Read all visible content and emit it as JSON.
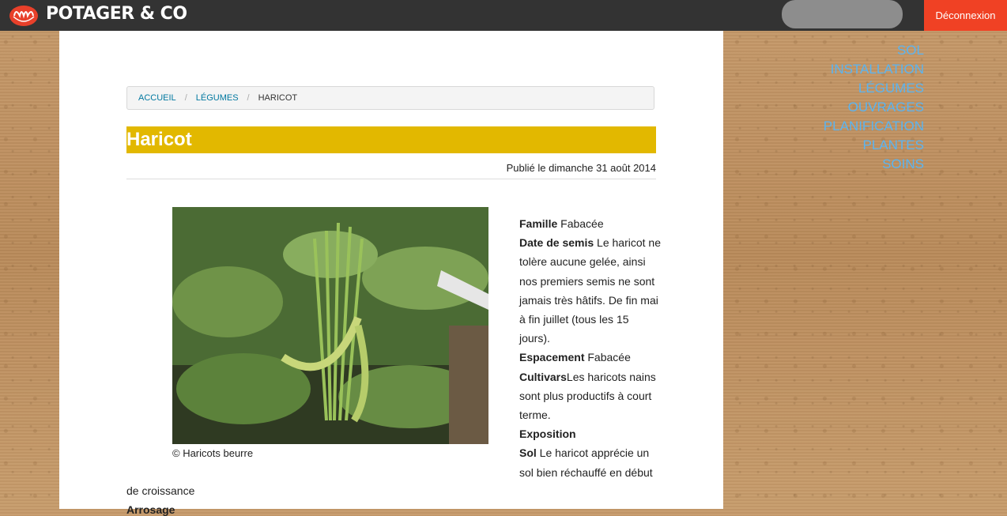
{
  "header": {
    "brand": "POTAGER & CO",
    "logout_label": "Déconnexion",
    "search_placeholder": ""
  },
  "breadcrumb": {
    "items": [
      "ACCUEIL",
      "LÉGUMES",
      "HARICOT"
    ]
  },
  "article": {
    "title": "Haricot",
    "published": "Publié le dimanche 31 août 2014",
    "caption": "© Haricots beurre",
    "famille_label": "Famille",
    "famille_value": " Fabacée",
    "semis_label": "Date de semis",
    "semis_value": " Le haricot ne tolère aucune gelée, ainsi nos premiers semis ne sont jamais très hâtifs. De fin mai à fin juillet (tous les 15 jours).",
    "espacement_label": "Espacement",
    "espacement_value": " Fabacée",
    "cultivars_label": "Cultivars",
    "cultivars_value": "Les haricots nains sont plus productifs à court terme.",
    "exposition_label": "Exposition",
    "sol_label": "Sol",
    "sol_value": " Le haricot apprécie un sol bien réchauffé en début",
    "continuation": "de croissance",
    "next_heading": "Arrosage"
  },
  "sidenav": {
    "items": [
      "SOL",
      "INSTALLATION",
      "LÉGUMES",
      "OUVRAGES",
      "PLANIFICATION",
      "PLANTES",
      "SOINS"
    ]
  },
  "colors": {
    "topbar": "#333333",
    "logout": "#f04124",
    "title_bg": "#e2b800",
    "link": "#0078a0",
    "sidenav_link": "#5bb4f0"
  }
}
